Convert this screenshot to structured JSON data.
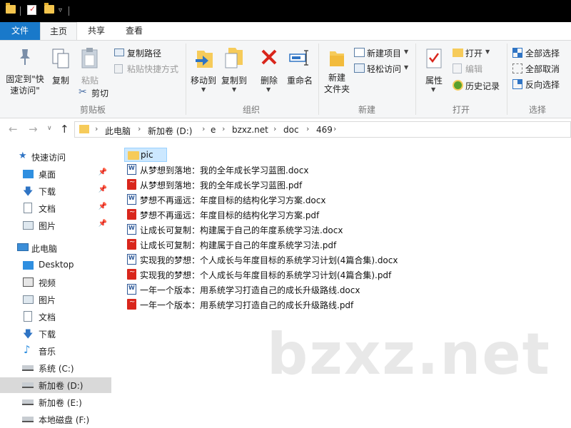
{
  "tabs": {
    "file": "文件",
    "home": "主页",
    "share": "共享",
    "view": "查看"
  },
  "ribbon": {
    "pin_quick_access": "固定到\"快速访问\"",
    "copy": "复制",
    "paste": "粘贴",
    "copy_path": "复制路径",
    "paste_shortcut": "粘贴快捷方式",
    "cut": "剪切",
    "move_to": "移动到",
    "copy_to": "复制到",
    "delete": "删除",
    "rename": "重命名",
    "new_folder": "新建\n文件夹",
    "new_item": "新建项目",
    "easy_access": "轻松访问",
    "properties": "属性",
    "open": "打开",
    "edit": "编辑",
    "history": "历史记录",
    "select_all": "全部选择",
    "select_none": "全部取消",
    "invert_selection": "反向选择",
    "groups": {
      "clipboard": "剪贴板",
      "organize": "组织",
      "new": "新建",
      "open": "打开",
      "select": "选择"
    }
  },
  "breadcrumb": [
    "此电脑",
    "新加卷 (D:)",
    "e",
    "bzxz.net",
    "doc",
    "469"
  ],
  "nav": {
    "quick_access": "快速访问",
    "quick_items": [
      "桌面",
      "下载",
      "文档",
      "图片"
    ],
    "this_pc": "此电脑",
    "pc_items": [
      "Desktop",
      "视频",
      "图片",
      "文档",
      "下载",
      "音乐",
      "系统 (C:)",
      "新加卷 (D:)",
      "新加卷 (E:)",
      "本地磁盘 (F:)"
    ]
  },
  "files": [
    {
      "name": "pic",
      "type": "folder"
    },
    {
      "name": "从梦想到落地：我的全年成长学习蓝图.docx",
      "type": "docx"
    },
    {
      "name": "从梦想到落地：我的全年成长学习蓝图.pdf",
      "type": "pdf"
    },
    {
      "name": "梦想不再遥远：年度目标的结构化学习方案.docx",
      "type": "docx"
    },
    {
      "name": "梦想不再遥远：年度目标的结构化学习方案.pdf",
      "type": "pdf"
    },
    {
      "name": "让成长可复制：构建属于自己的年度系统学习法.docx",
      "type": "docx"
    },
    {
      "name": "让成长可复制：构建属于自己的年度系统学习法.pdf",
      "type": "pdf"
    },
    {
      "name": "实现我的梦想：个人成长与年度目标的系统学习计划(4篇合集).docx",
      "type": "docx"
    },
    {
      "name": "实现我的梦想：个人成长与年度目标的系统学习计划(4篇合集).pdf",
      "type": "pdf"
    },
    {
      "name": "一年一个版本：用系统学习打造自己的成长升级路线.docx",
      "type": "docx"
    },
    {
      "name": "一年一个版本：用系统学习打造自己的成长升级路线.pdf",
      "type": "pdf"
    }
  ],
  "watermark": "bzxz.net"
}
